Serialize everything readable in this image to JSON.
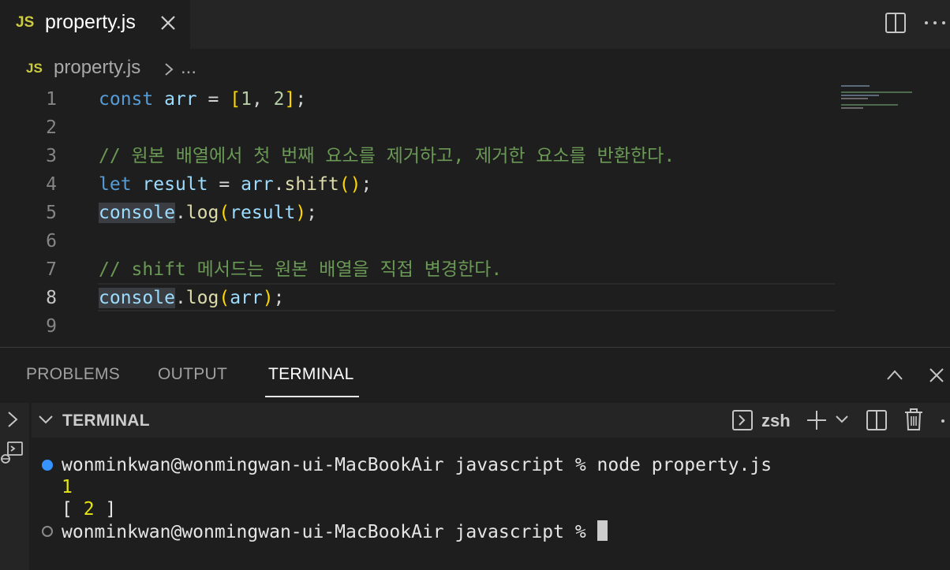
{
  "tab": {
    "lang_badge": "JS",
    "title": "property.js"
  },
  "breadcrumb": {
    "lang_badge": "JS",
    "file": "property.js",
    "ellipsis": "..."
  },
  "editor": {
    "line_numbers": [
      "1",
      "2",
      "3",
      "4",
      "5",
      "6",
      "7",
      "8",
      "9"
    ],
    "active_line": "8",
    "comment_3": "// 원본 배열에서 첫 번째 요소를 제거하고, 제거한 요소를 반환한다.",
    "comment_7": "// shift 메서드는 원본 배열을 직접 변경한다.",
    "tokens": {
      "const": "const",
      "arr": "arr",
      "eq": "=",
      "lbracket": "[",
      "one": "1",
      "comma": ",",
      "two": "2",
      "rbracket": "]",
      "semi": ";",
      "let": "let",
      "result": "result",
      "dot": ".",
      "shift": "shift",
      "lparen": "(",
      "rparen": ")",
      "console": "console",
      "log": "log"
    }
  },
  "panel": {
    "tabs": [
      {
        "label": "PROBLEMS"
      },
      {
        "label": "OUTPUT"
      },
      {
        "label": "TERMINAL",
        "active": true
      }
    ],
    "terminal_header": "TERMINAL",
    "shell": "zsh"
  },
  "terminal": {
    "line1_prompt": "wonminkwan@wonmingwan-ui-MacBookAir javascript % ",
    "line1_cmd": "node property.js",
    "line2": "1",
    "line3_open": "[ ",
    "line3_val": "2",
    "line3_close": " ]",
    "line4_prompt": "wonminkwan@wonmingwan-ui-MacBookAir javascript % "
  },
  "colors": {
    "keyword": "#569cd6",
    "variable": "#9cdcfe",
    "number": "#b5cea8",
    "function": "#dcdcaa",
    "bracket": "#ffd700",
    "comment": "#6a9955",
    "js_badge": "#cbcb41",
    "status_dot": "#3794ff"
  },
  "icons": [
    "close-icon",
    "split-editor-icon",
    "more-actions-icon",
    "chevron-right-icon",
    "chevron-up-icon",
    "chevron-down-icon",
    "terminal-shell-icon",
    "plus-icon",
    "split-terminal-icon",
    "trash-icon",
    "debug-console-icon"
  ]
}
